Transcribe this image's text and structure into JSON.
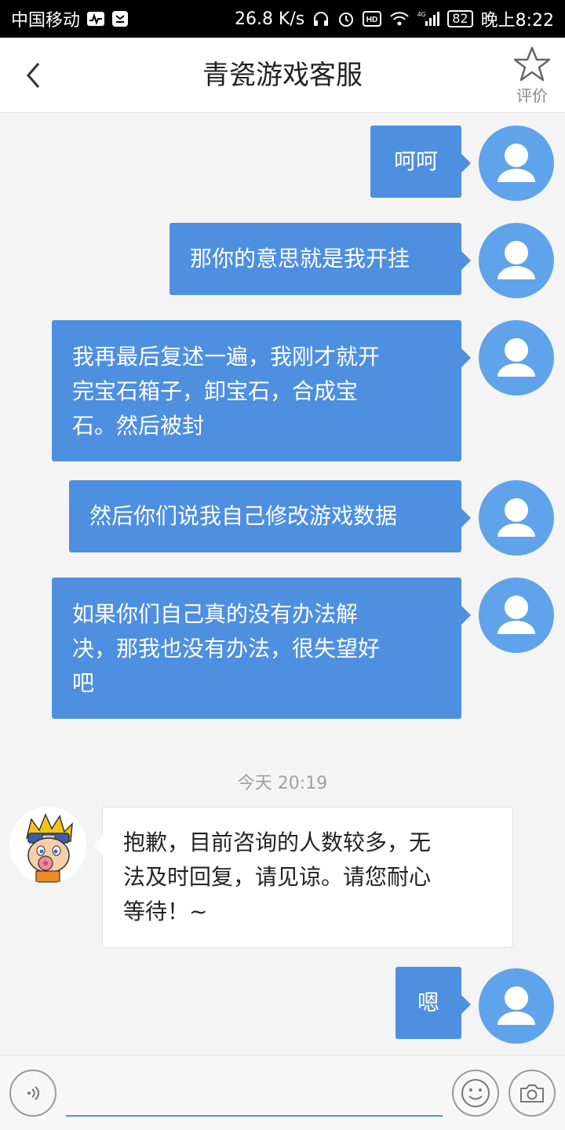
{
  "status_bar": {
    "carrier": "中国移动",
    "speed": "26.8 K/s",
    "network": "4G",
    "battery": "82",
    "time": "晚上8:22"
  },
  "header": {
    "title": "青瓷游戏客服",
    "back_icon": "chevron-left-icon",
    "rate_label": "评价",
    "rate_icon": "star-outline-icon"
  },
  "messages": {
    "m1": "呵呵",
    "m2": "那你的意思就是我开挂",
    "m3": [
      "我再最后复述一遍，我刚才就开",
      "完宝石箱子，卸宝石，合成宝",
      "石。然后被封"
    ],
    "m4": "然后你们说我自己修改游戏数据",
    "m5": [
      "如果你们自己真的没有办法解",
      "决，那我也没有办法，很失望好",
      "吧"
    ],
    "timestamp": "今天 20:19",
    "agent": [
      "抱歉，目前咨询的人数较多，无",
      "法及时回复，请见谅。请您耐心",
      "等待！~"
    ],
    "m6": "嗯"
  },
  "colors": {
    "bubble_out": "#4e8fe0",
    "avatar_bg": "#5fa3ea",
    "background": "#f4f4f4"
  },
  "input_bar": {
    "placeholder": "",
    "voice_icon": "voice-icon",
    "emoji_icon": "emoji-icon",
    "camera_icon": "camera-icon"
  }
}
